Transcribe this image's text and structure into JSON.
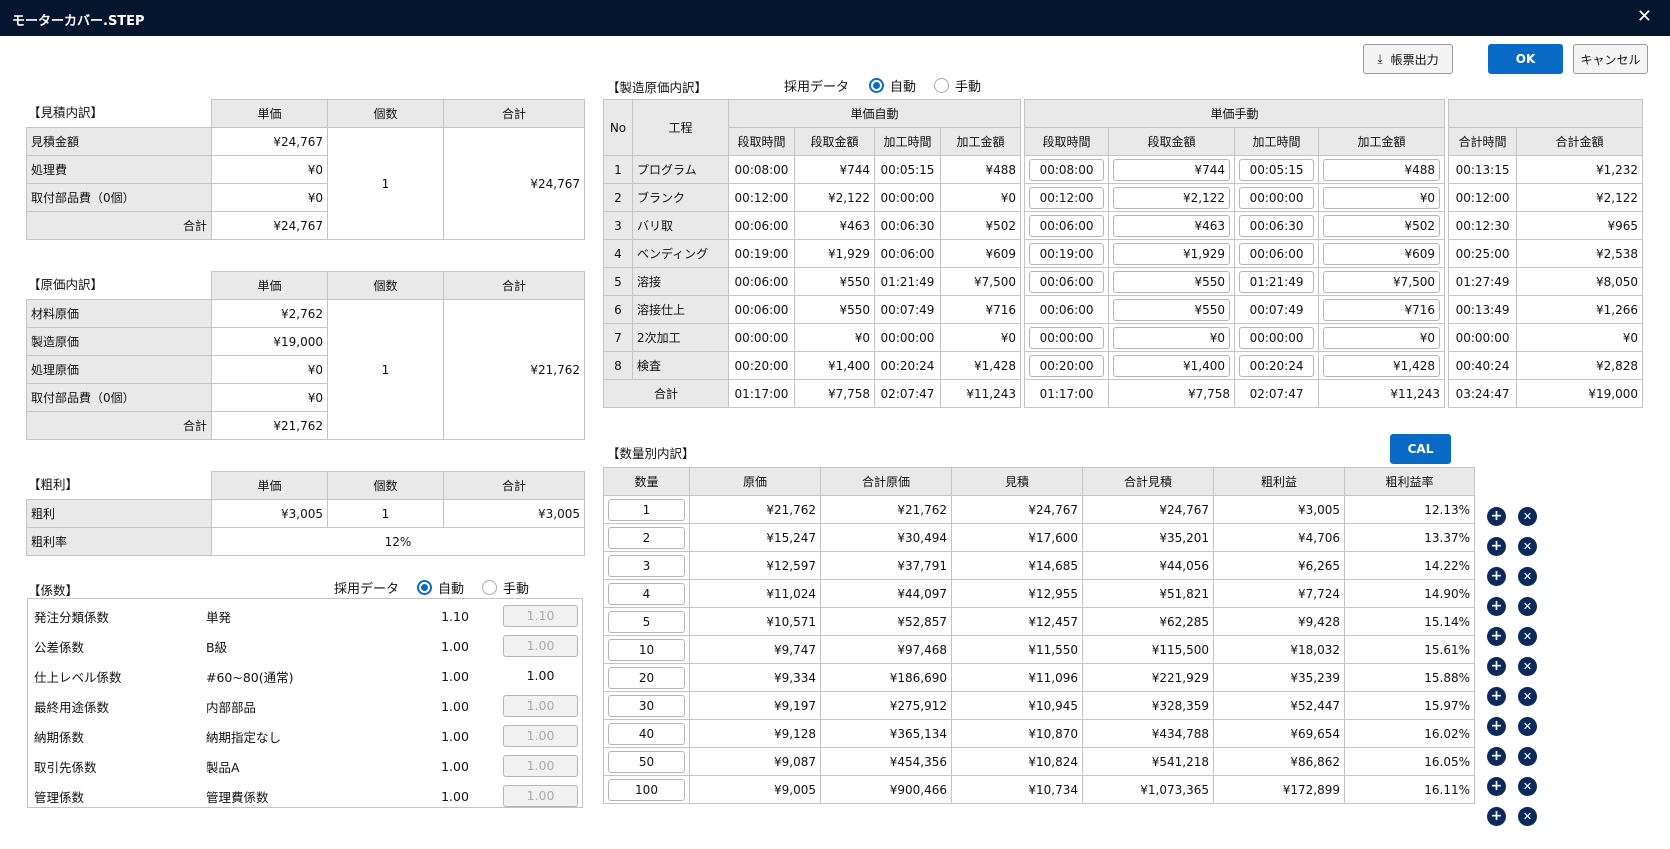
{
  "window": {
    "title": "モーターカバー.STEP"
  },
  "buttons": {
    "export": "帳票出力",
    "ok": "OK",
    "cancel": "キャンセル",
    "cal": "CAL"
  },
  "sections": {
    "estimate": "【見積内訳】",
    "cost": "【原価内訳】",
    "profit": "【粗利】",
    "coef": "【係数】",
    "manufacturing": "【製造原価内訳】",
    "quantity": "【数量別内訳】"
  },
  "adopt": {
    "label": "採用データ",
    "auto": "自動",
    "manual": "手動"
  },
  "estimate": {
    "headers": [
      "単価",
      "個数",
      "合計"
    ],
    "rows": [
      {
        "label": "見積金額",
        "unit": "¥24,767"
      },
      {
        "label": "処理費",
        "unit": "¥0"
      },
      {
        "label": "取付部品費（0個）",
        "unit": "¥0"
      },
      {
        "label": "合計",
        "unit": "¥24,767"
      }
    ],
    "qty": "1",
    "total": "¥24,767"
  },
  "cost": {
    "headers": [
      "単価",
      "個数",
      "合計"
    ],
    "rows": [
      {
        "label": "材料原価",
        "unit": "¥2,762"
      },
      {
        "label": "製造原価",
        "unit": "¥19,000"
      },
      {
        "label": "処理原価",
        "unit": "¥0"
      },
      {
        "label": "取付部品費（0個）",
        "unit": "¥0"
      },
      {
        "label": "合計",
        "unit": "¥21,762"
      }
    ],
    "qty": "1",
    "total": "¥21,762"
  },
  "profit": {
    "headers": [
      "単価",
      "個数",
      "合計"
    ],
    "row1": {
      "label": "粗利",
      "unit": "¥3,005",
      "qty": "1",
      "total": "¥3,005"
    },
    "row2": {
      "label": "粗利率",
      "value": "12%"
    }
  },
  "coef": {
    "rows": [
      {
        "name": "発注分類係数",
        "type": "単発",
        "value": "1.10",
        "manual": "1.10",
        "manual_enabled": false
      },
      {
        "name": "公差係数",
        "type": "B級",
        "value": "1.00",
        "manual": "1.00",
        "manual_enabled": false
      },
      {
        "name": "仕上レベル係数",
        "type": "#60~80(通常)",
        "value": "1.00",
        "manual": "1.00",
        "manual_enabled": true
      },
      {
        "name": "最終用途係数",
        "type": "内部部品",
        "value": "1.00",
        "manual": "1.00",
        "manual_enabled": false
      },
      {
        "name": "納期係数",
        "type": "納期指定なし",
        "value": "1.00",
        "manual": "1.00",
        "manual_enabled": false
      },
      {
        "name": "取引先係数",
        "type": "製品A",
        "value": "1.00",
        "manual": "1.00",
        "manual_enabled": false
      },
      {
        "name": "管理係数",
        "type": "管理費係数",
        "value": "1.00",
        "manual": "1.00",
        "manual_enabled": false
      }
    ]
  },
  "manufacturing": {
    "group_auto": "単価自動",
    "group_manual": "単価手動",
    "col_no": "No",
    "col_process": "工程",
    "sub": [
      "段取時間",
      "段取金額",
      "加工時間",
      "加工金額"
    ],
    "sum_headers": [
      "合計時間",
      "合計金額"
    ],
    "rows": [
      {
        "no": "1",
        "proc": "プログラム",
        "a": [
          "00:08:00",
          "¥744",
          "00:05:15",
          "¥488"
        ],
        "m": [
          "00:08:00",
          "¥744",
          "00:05:15",
          "¥488"
        ],
        "s": [
          "00:13:15",
          "¥1,232"
        ]
      },
      {
        "no": "2",
        "proc": "ブランク",
        "a": [
          "00:12:00",
          "¥2,122",
          "00:00:00",
          "¥0"
        ],
        "m": [
          "00:12:00",
          "¥2,122",
          "00:00:00",
          "¥0"
        ],
        "s": [
          "00:12:00",
          "¥2,122"
        ]
      },
      {
        "no": "3",
        "proc": "バリ取",
        "a": [
          "00:06:00",
          "¥463",
          "00:06:30",
          "¥502"
        ],
        "m": [
          "00:06:00",
          "¥463",
          "00:06:30",
          "¥502"
        ],
        "s": [
          "00:12:30",
          "¥965"
        ]
      },
      {
        "no": "4",
        "proc": "ベンディング",
        "a": [
          "00:19:00",
          "¥1,929",
          "00:06:00",
          "¥609"
        ],
        "m": [
          "00:19:00",
          "¥1,929",
          "00:06:00",
          "¥609"
        ],
        "s": [
          "00:25:00",
          "¥2,538"
        ]
      },
      {
        "no": "5",
        "proc": "溶接",
        "a": [
          "00:06:00",
          "¥550",
          "01:21:49",
          "¥7,500"
        ],
        "m": [
          "00:06:00",
          "¥550",
          "01:21:49",
          "¥7,500"
        ],
        "s": [
          "01:27:49",
          "¥8,050"
        ]
      },
      {
        "no": "6",
        "proc": "溶接仕上",
        "a": [
          "00:06:00",
          "¥550",
          "00:07:49",
          "¥716"
        ],
        "m": [
          "00:06:00",
          "¥550",
          "00:07:49",
          "¥716"
        ],
        "s": [
          "00:13:49",
          "¥1,266"
        ],
        "plain_time": true
      },
      {
        "no": "7",
        "proc": "2次加工",
        "a": [
          "00:00:00",
          "¥0",
          "00:00:00",
          "¥0"
        ],
        "m": [
          "00:00:00",
          "¥0",
          "00:00:00",
          "¥0"
        ],
        "s": [
          "00:00:00",
          "¥0"
        ]
      },
      {
        "no": "8",
        "proc": "検査",
        "a": [
          "00:20:00",
          "¥1,400",
          "00:20:24",
          "¥1,428"
        ],
        "m": [
          "00:20:00",
          "¥1,400",
          "00:20:24",
          "¥1,428"
        ],
        "s": [
          "00:40:24",
          "¥2,828"
        ]
      }
    ],
    "total": {
      "label": "合計",
      "a": [
        "01:17:00",
        "¥7,758",
        "02:07:47",
        "¥11,243"
      ],
      "m": [
        "01:17:00",
        "¥7,758",
        "02:07:47",
        "¥11,243"
      ],
      "s": [
        "03:24:47",
        "¥19,000"
      ]
    }
  },
  "quantity": {
    "headers": [
      "数量",
      "原価",
      "合計原価",
      "見積",
      "合計見積",
      "粗利益",
      "粗利益率"
    ],
    "rows": [
      [
        "1",
        "¥21,762",
        "¥21,762",
        "¥24,767",
        "¥24,767",
        "¥3,005",
        "12.13%"
      ],
      [
        "2",
        "¥15,247",
        "¥30,494",
        "¥17,600",
        "¥35,201",
        "¥4,706",
        "13.37%"
      ],
      [
        "3",
        "¥12,597",
        "¥37,791",
        "¥14,685",
        "¥44,056",
        "¥6,265",
        "14.22%"
      ],
      [
        "4",
        "¥11,024",
        "¥44,097",
        "¥12,955",
        "¥51,821",
        "¥7,724",
        "14.90%"
      ],
      [
        "5",
        "¥10,571",
        "¥52,857",
        "¥12,457",
        "¥62,285",
        "¥9,428",
        "15.14%"
      ],
      [
        "10",
        "¥9,747",
        "¥97,468",
        "¥11,550",
        "¥115,500",
        "¥18,032",
        "15.61%"
      ],
      [
        "20",
        "¥9,334",
        "¥186,690",
        "¥11,096",
        "¥221,929",
        "¥35,239",
        "15.88%"
      ],
      [
        "30",
        "¥9,197",
        "¥275,912",
        "¥10,945",
        "¥328,359",
        "¥52,447",
        "15.97%"
      ],
      [
        "40",
        "¥9,128",
        "¥365,134",
        "¥10,870",
        "¥434,788",
        "¥69,654",
        "16.02%"
      ],
      [
        "50",
        "¥9,087",
        "¥454,356",
        "¥10,824",
        "¥541,218",
        "¥86,862",
        "16.05%"
      ],
      [
        "100",
        "¥9,005",
        "¥900,466",
        "¥10,734",
        "¥1,073,365",
        "¥172,899",
        "16.11%"
      ]
    ],
    "add_icon": "plus-icon",
    "remove_icon": "close-icon"
  }
}
